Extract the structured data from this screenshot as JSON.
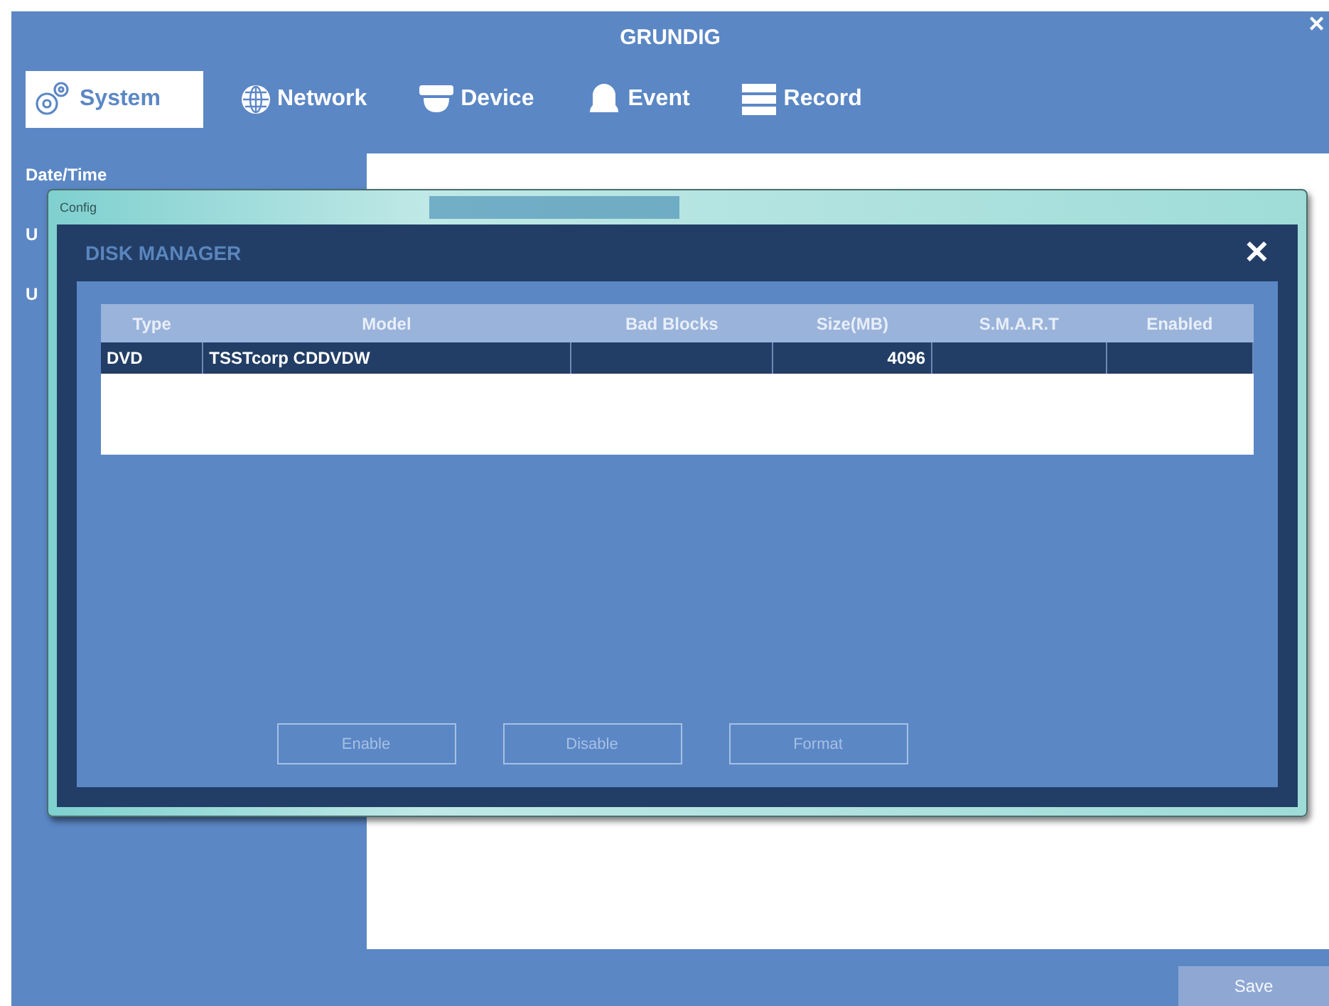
{
  "window": {
    "title": "GRUNDIG",
    "close": "✕"
  },
  "tabs": [
    {
      "label": "System",
      "selected": true
    },
    {
      "label": "Network",
      "selected": false
    },
    {
      "label": "Device",
      "selected": false
    },
    {
      "label": "Event",
      "selected": false
    },
    {
      "label": "Record",
      "selected": false
    }
  ],
  "sidebar": {
    "heading": "Date/Time",
    "items": [
      "U",
      "U"
    ]
  },
  "save_button": {
    "label": "Save",
    "disabled": true
  },
  "config_window": {
    "title": "Config",
    "dialog": {
      "title": "DISK MANAGER",
      "close": "✕",
      "table": {
        "columns": [
          "Type",
          "Model",
          "Bad Blocks",
          "Size(MB)",
          "S.M.A.R.T",
          "Enabled"
        ],
        "rows": [
          {
            "selected": true,
            "cells": [
              "DVD",
              "TSSTcorp CDDVDW",
              "",
              "4096",
              "",
              ""
            ]
          }
        ]
      },
      "buttons": [
        {
          "label": "Enable",
          "disabled": true
        },
        {
          "label": "Disable",
          "disabled": true
        },
        {
          "label": "Format",
          "disabled": true
        }
      ]
    }
  }
}
